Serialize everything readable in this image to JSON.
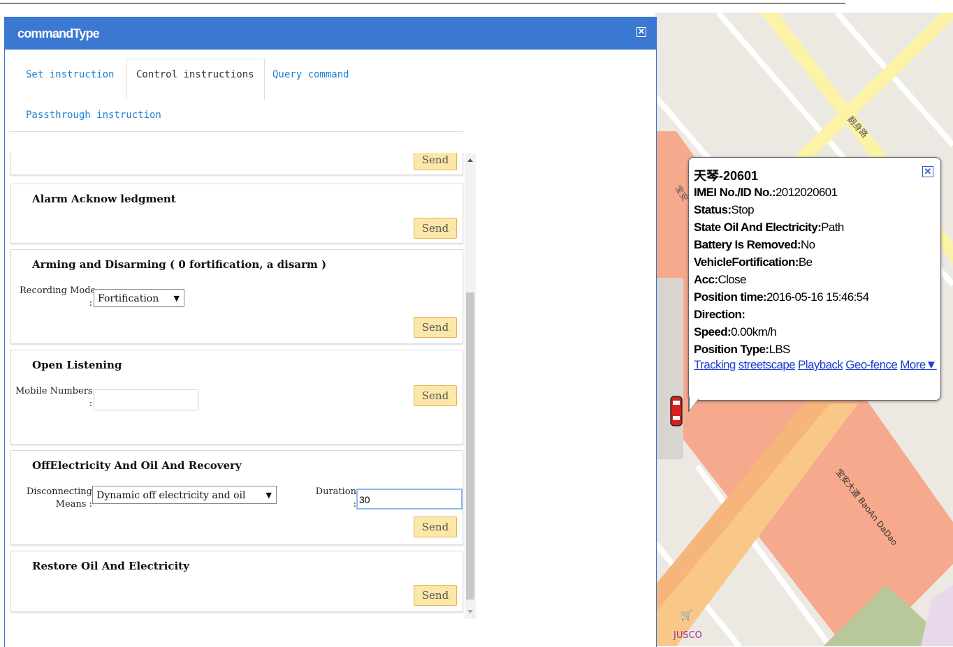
{
  "dialog": {
    "title": "commandType",
    "close_symbol": "✕"
  },
  "tabs": [
    {
      "label": "Set instruction",
      "active": false
    },
    {
      "label": "Control instructions",
      "active": true
    },
    {
      "label": "Query command",
      "active": false
    },
    {
      "label": "Passthrough instruction",
      "active": false
    }
  ],
  "send_label": "Send",
  "commands": {
    "alarm": {
      "title": "Alarm Acknow ledgment"
    },
    "arming": {
      "title": "Arming and Disarming ( 0 fortification, a disarm )",
      "mode_label": "Recording Mode",
      "mode_colon": ":",
      "mode_value": "Fortification"
    },
    "listening": {
      "title": "Open Listening",
      "numbers_label": "Mobile Numbers",
      "numbers_colon": ":",
      "numbers_value": ""
    },
    "offelec": {
      "title": "OffElectricity And Oil And Recovery",
      "means_label_1": "Disconnecting",
      "means_label_2": "Means",
      "means_colon": ":",
      "means_value": "Dynamic off electricity and oil",
      "duration_label": "Duration",
      "duration_colon": ":",
      "duration_value": "30"
    },
    "restore": {
      "title": "Restore Oil And Electricity"
    }
  },
  "popup": {
    "title": "天琴-20601",
    "rows": [
      {
        "key": "IMEI No./ID No.:",
        "value": "2012020601"
      },
      {
        "key": "Status:",
        "value": "Stop"
      },
      {
        "key": "State Oil And Electricity:",
        "value": "Path"
      },
      {
        "key": "Battery Is Removed:",
        "value": "No"
      },
      {
        "key": "VehicleFortification:",
        "value": "Be"
      },
      {
        "key": "Acc:",
        "value": "Close"
      },
      {
        "key": "Position time:",
        "value": "2016-05-16 15:46:54"
      },
      {
        "key": "Direction:",
        "value": ""
      },
      {
        "key": "Speed:",
        "value": "0.00km/h"
      },
      {
        "key": "Position Type:",
        "value": "LBS"
      }
    ],
    "links": [
      "Tracking",
      "streetscape",
      "Playback",
      "Geo-fence",
      "More▼"
    ]
  },
  "map": {
    "labels": {
      "road1": "翻身路",
      "road2": "宝安大道 BaoAn DaDao",
      "road3": "宝安",
      "poi": "JUSCO"
    },
    "colors": {
      "major_road": "#f6a98c",
      "arterial": "#f9c889",
      "minor_road": "#fdf3a6",
      "park": "#b9c89a",
      "land": "#ece8e2"
    }
  },
  "colors": {
    "header": "#3b78d2",
    "link": "#1f7fd2",
    "send_bg": "#fbe7a8"
  }
}
